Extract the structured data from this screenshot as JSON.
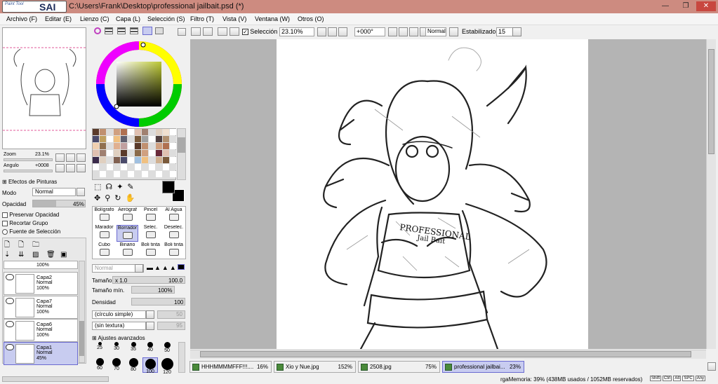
{
  "window": {
    "title": "C:\\Users\\Frank\\Desktop\\professional jailbait.psd (*)",
    "logo_small": "Paint Tool",
    "logo_big": "SAI"
  },
  "menu": [
    "Archivo (F)",
    "Editar (E)",
    "Lienzo (C)",
    "Capa (L)",
    "Selección (S)",
    "Filtro (T)",
    "Vista (V)",
    "Ventana (W)",
    "Otros (O)"
  ],
  "toolbar": {
    "selection_label": "Selección",
    "zoom": "23.10%",
    "angle": "+000°",
    "blend": "Normal",
    "stabilizer_label": "Estabilizador",
    "stabilizer": "15"
  },
  "navigator": {
    "zoom_label": "Zoom",
    "zoom_value": "23.1%",
    "angle_label": "Angulo",
    "angle_value": "+0008"
  },
  "effects": {
    "header": "Efectos de Pinturas",
    "mode_label": "Modo",
    "mode_value": "Normal",
    "opacity_label": "Opacidad",
    "opacity_value": "45%",
    "preserve": "Preservar Opacidad",
    "clip": "Recortar Grupo",
    "selection_source": "Fuente de Selección"
  },
  "layers": {
    "partial_opacity": "100%",
    "items": [
      {
        "name": "Capa2",
        "mode": "Normal",
        "opacity": "100%"
      },
      {
        "name": "Capa7",
        "mode": "Normal",
        "opacity": "100%"
      },
      {
        "name": "Capa6",
        "mode": "Normal",
        "opacity": "100%"
      },
      {
        "name": "Capa1",
        "mode": "Normal",
        "opacity": "45%"
      }
    ]
  },
  "tools": [
    [
      "Bolígrafo",
      "Aerógraf",
      "Pincel",
      "Al Agua"
    ],
    [
      "Marador",
      "Borrador",
      "Selec.",
      "Deselec."
    ],
    [
      "Cubo",
      "Binario",
      "Boli tinta",
      "Boli tinta"
    ]
  ],
  "brush": {
    "mode": "Normal",
    "size_label": "Tamaño",
    "size_mult": "x 1.0",
    "size_value": "100.0",
    "min_label": "Tamaño mín.",
    "min_value": "100%",
    "density_label": "Densidad",
    "density_value": "100",
    "shape": "(círculo simple)",
    "shape_value": "50",
    "texture": "(sin textura)",
    "texture_value": "95",
    "advanced": "Ajustes avanzados",
    "sizes_row1": [
      "25",
      "30",
      "35",
      "40",
      "50"
    ],
    "sizes_row2": [
      "60",
      "70",
      "80",
      "100",
      "120"
    ]
  },
  "tabs": [
    {
      "name": "HHHMMMMFFF!!!....",
      "pct": "16%"
    },
    {
      "name": "Xio y Nue.jpg",
      "pct": "152%"
    },
    {
      "name": "2508.jpg",
      "pct": "75%"
    },
    {
      "name": "professional jailbai...",
      "pct": "23%"
    }
  ],
  "status": {
    "memory": "rgaMemoria: 39% (438MB usados / 1052MB reservados)",
    "keys": [
      "Shift",
      "Ctrl",
      "Alt",
      "SPC",
      "Any"
    ]
  },
  "canvas_text": {
    "line1": "PROFESSIONAL",
    "line2": "Jail Bait"
  }
}
